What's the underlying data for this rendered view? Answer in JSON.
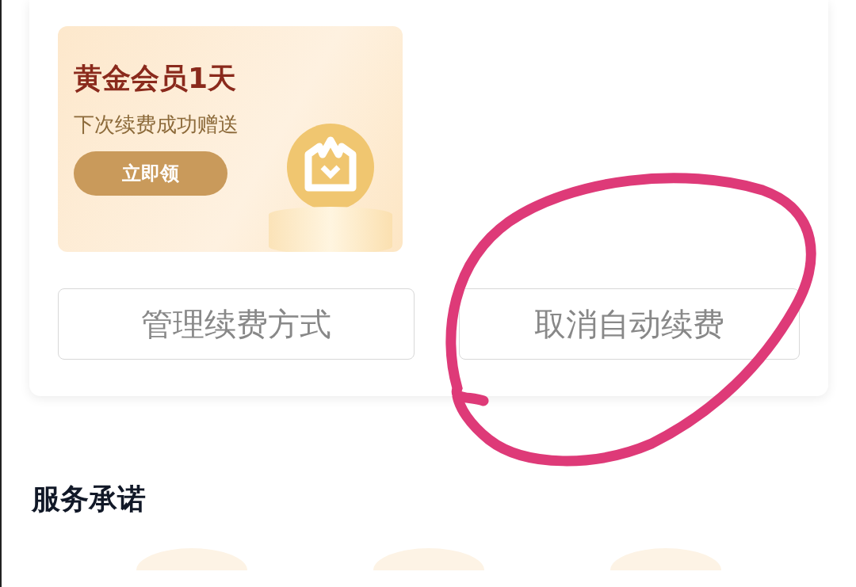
{
  "promo": {
    "title": "黄金会员1天",
    "subtitle": "下次续费成功赠送",
    "button": "立即领"
  },
  "actions": [
    {
      "label": "管理续费方式"
    },
    {
      "label": "取消自动续费"
    }
  ],
  "section": {
    "title": "服务承诺"
  }
}
